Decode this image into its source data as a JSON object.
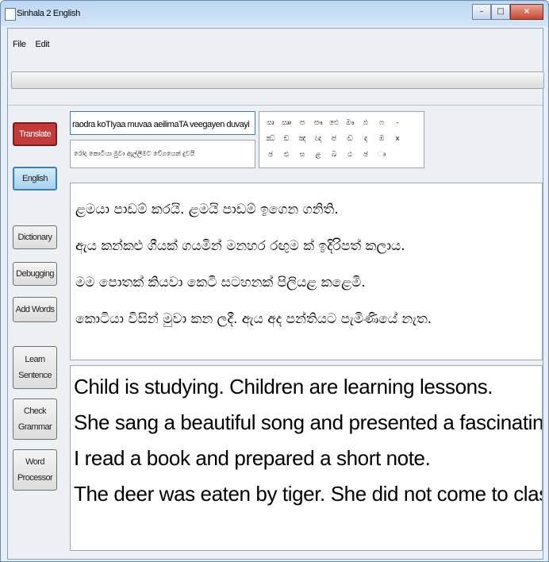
{
  "window": {
    "title": "Sinhala 2 English",
    "controls": {
      "minimize": "–",
      "maximize": "□",
      "close": "×"
    }
  },
  "menu": {
    "items": [
      "File",
      "Edit"
    ]
  },
  "progress": {
    "value_percent": 0
  },
  "buttons": {
    "translate": "Translate",
    "english": "English",
    "dictionary": "Dictionary",
    "debugging": "Debugging",
    "add_words": "Add Words",
    "learn_sentence": "Learn Sentence",
    "check_grammar": "Check Grammar",
    "word_processor": "Word Processor"
  },
  "inputs": {
    "romanized": "raodra koTIyaa muvaa aeilimaTA veegayen duvayi",
    "sinhala_preview": "රෝද කොටියා මුවා ඇල්ලීමට වේගයෙන් දුවයි"
  },
  "char_pad": {
    "rows": [
      [
        "ඍ",
        "ඎ",
        "ඏ",
        "ඐ",
        "ඓ",
        "ඖ",
        "ඵ",
        "ෆ",
        "-"
      ],
      [
        "ඣ",
        "ඞ",
        "ඤ",
        "ඥ",
        "ඦ",
        "ඬ",
        "ඳ",
        "ඹ",
        "x"
      ],
      [
        "ඡ",
        "ඪ",
        "ඝ",
        "ළ",
        "ඛ",
        "ඨ",
        "ඡ",
        "ෘ"
      ]
    ]
  },
  "sinhala_text": [
    "ළමයා පාඩම් කරයි.   ළමයි පාඩම් ඉගෙන ගනිති.",
    "ඇය කන්කළු ගීයක් ගයමින්  මනහර රඟුම ක් ඉදිරිපත් කලාය.",
    "මම පොතක් කියවා කෙටි සටහනක් පිලියළ කළෙමි.",
    "කොටියා විසින් මුවා කන ලදී.  ඇය අද පන්තියට පැමිණියේ නැත."
  ],
  "english_text": [
    "Child is studying.  Children are learning lessons.",
    "She sang a beautiful song and presented a fascinating dance.",
    "I read a book and prepared a short note.",
    "The deer was eaten by tiger. She did not come to class today."
  ],
  "colors": {
    "translate_button": "#c23a3a",
    "english_button": "#a5d2f1",
    "titlebar": "#bcd6f1"
  }
}
